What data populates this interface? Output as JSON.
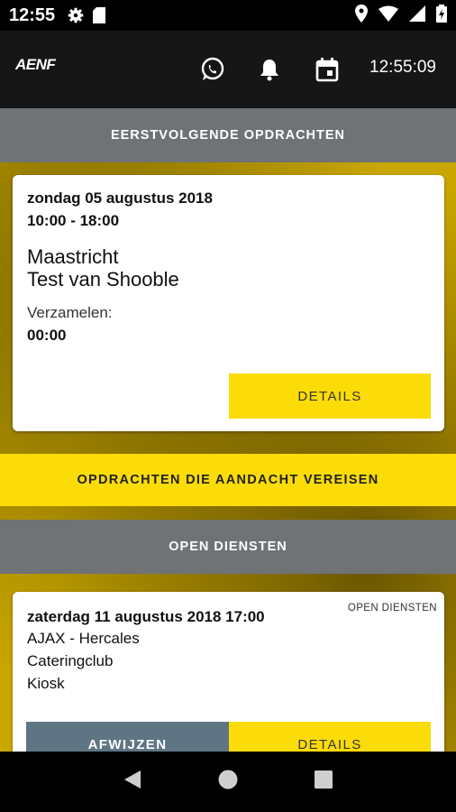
{
  "status_bar": {
    "time": "12:55"
  },
  "app_bar": {
    "logo": "AENF",
    "clock": "12:55:09"
  },
  "sections": {
    "upcoming_header": "EERSTVOLGENDE OPDRACHTEN",
    "attention_header": "OPDRACHTEN DIE AANDACHT VEREISEN",
    "open_header": "OPEN DIENSTEN"
  },
  "upcoming_card": {
    "date": "zondag 05 augustus 2018",
    "time": "10:00 - 18:00",
    "location": "Maastricht",
    "event": "Test van Shooble",
    "collect_label": "Verzamelen:",
    "collect_time": "00:00",
    "details_label": "DETAILS"
  },
  "open_card": {
    "tag": "OPEN DIENSTEN",
    "datetime": "zaterdag 11 augustus 2018 17:00",
    "match": "AJAX - Hercales",
    "club": "Cateringclub",
    "role": "Kiosk",
    "reject_label": "AFWIJZEN",
    "details_label": "DETAILS"
  },
  "colors": {
    "accent": "#fbdc06",
    "section_gray": "#6f7376",
    "reject_button": "#5f7584",
    "app_bar": "#161616"
  }
}
